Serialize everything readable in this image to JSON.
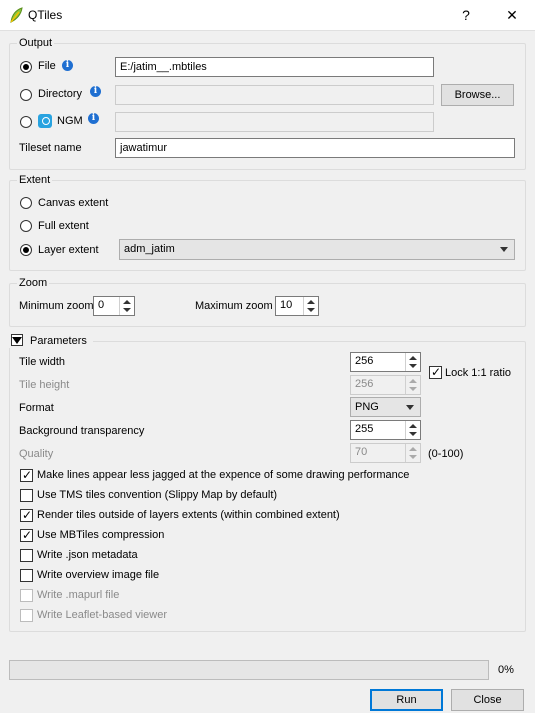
{
  "window": {
    "title": "QTiles",
    "help_glyph": "?",
    "close_glyph": "✕",
    "app_icon": "qgis-leaf-icon"
  },
  "output": {
    "legend": "Output",
    "file": {
      "label": "File",
      "value": "E:/jatim__.mbtiles",
      "selected": true
    },
    "directory": {
      "label": "Directory",
      "value": "",
      "browse_label": "Browse..."
    },
    "ngm": {
      "label": "NGM",
      "value": ""
    },
    "tileset": {
      "label": "Tileset name",
      "value": "jawatimur"
    }
  },
  "extent": {
    "legend": "Extent",
    "canvas": "Canvas extent",
    "full": "Full extent",
    "layer": "Layer extent",
    "layer_value": "adm_jatim",
    "selected": "layer"
  },
  "zoom": {
    "legend": "Zoom",
    "min_label": "Minimum zoom",
    "min_value": "0",
    "max_label": "Maximum zoom",
    "max_value": "10"
  },
  "parameters": {
    "legend": "Parameters",
    "tile_width": {
      "label": "Tile width",
      "value": "256"
    },
    "tile_height": {
      "label": "Tile height",
      "value": "256"
    },
    "lock_ratio": {
      "label": "Lock 1:1 ratio",
      "checked": true
    },
    "format": {
      "label": "Format",
      "value": "PNG"
    },
    "bg_transparency": {
      "label": "Background transparency",
      "value": "255"
    },
    "quality": {
      "label": "Quality",
      "value": "70",
      "range": "(0-100)"
    },
    "options": [
      {
        "label": "Make lines appear less jagged at the expence of some drawing performance",
        "checked": true,
        "enabled": true
      },
      {
        "label": "Use TMS tiles convention (Slippy Map by default)",
        "checked": false,
        "enabled": true
      },
      {
        "label": "Render tiles outside of layers extents (within combined extent)",
        "checked": true,
        "enabled": true
      },
      {
        "label": "Use MBTiles compression",
        "checked": true,
        "enabled": true
      },
      {
        "label": "Write .json metadata",
        "checked": false,
        "enabled": true
      },
      {
        "label": "Write overview image file",
        "checked": false,
        "enabled": true
      },
      {
        "label": "Write .mapurl file",
        "checked": false,
        "enabled": false
      },
      {
        "label": "Write Leaflet-based viewer",
        "checked": false,
        "enabled": false
      }
    ]
  },
  "progress": {
    "value": 0,
    "text": "0%"
  },
  "buttons": {
    "run": "Run",
    "close": "Close"
  }
}
